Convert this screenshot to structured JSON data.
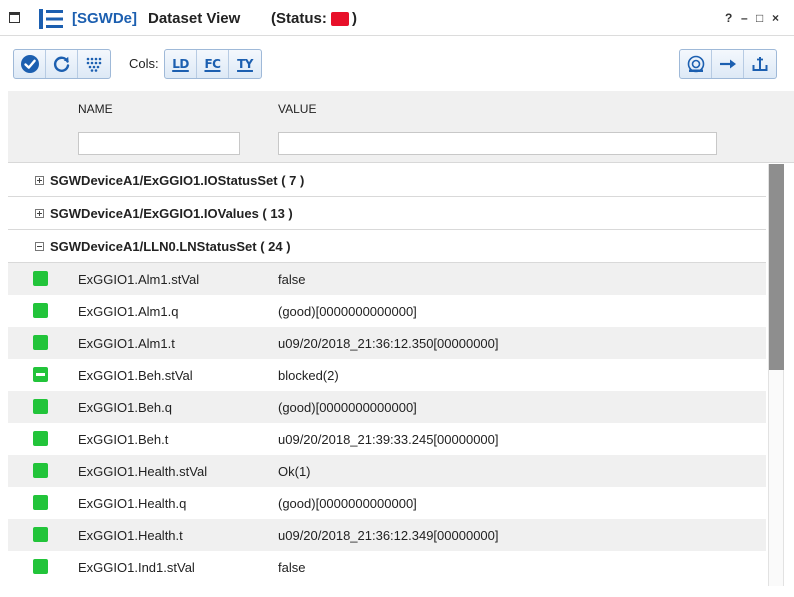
{
  "window": {
    "app_tag": "[SGWDe]",
    "view_title": "Dataset View",
    "status_prefix": "(Status:",
    "status_suffix": ")",
    "status_color": "#e8102a",
    "controls": [
      "?",
      "–",
      "□",
      "×"
    ]
  },
  "toolbar": {
    "left_buttons": [
      "check-circle-icon",
      "refresh-icon",
      "dots-grid-icon"
    ],
    "cols_label": "Cols:",
    "col_buttons": [
      "LD",
      "FC",
      "TY"
    ],
    "right_buttons": [
      "camera-icon",
      "arrow-right-icon",
      "anchor-icon"
    ],
    "accent_color": "#1c5fb0"
  },
  "columns": {
    "name_header": "NAME",
    "value_header": "VALUE",
    "name_filter": "",
    "value_filter": ""
  },
  "groups": [
    {
      "label": "SGWDeviceA1/ExGGIO1.IOStatusSet ( 7 )",
      "expanded": false
    },
    {
      "label": "SGWDeviceA1/ExGGIO1.IOValues ( 13 )",
      "expanded": false
    },
    {
      "label": "SGWDeviceA1/LLN0.LNStatusSet ( 24 )",
      "expanded": true
    }
  ],
  "rows": [
    {
      "name": "ExGGIO1.Alm1.stVal",
      "value": "false",
      "status": "good"
    },
    {
      "name": "ExGGIO1.Alm1.q",
      "value": "(good)[0000000000000]",
      "status": "good"
    },
    {
      "name": "ExGGIO1.Alm1.t",
      "value": "u09/20/2018_21:36:12.350[00000000]",
      "status": "good"
    },
    {
      "name": "ExGGIO1.Beh.stVal",
      "value": "blocked(2)",
      "status": "blocked"
    },
    {
      "name": "ExGGIO1.Beh.q",
      "value": "(good)[0000000000000]",
      "status": "good"
    },
    {
      "name": "ExGGIO1.Beh.t",
      "value": "u09/20/2018_21:39:33.245[00000000]",
      "status": "good"
    },
    {
      "name": "ExGGIO1.Health.stVal",
      "value": "Ok(1)",
      "status": "good"
    },
    {
      "name": "ExGGIO1.Health.q",
      "value": "(good)[0000000000000]",
      "status": "good"
    },
    {
      "name": "ExGGIO1.Health.t",
      "value": "u09/20/2018_21:36:12.349[00000000]",
      "status": "good"
    },
    {
      "name": "ExGGIO1.Ind1.stVal",
      "value": "false",
      "status": "good"
    }
  ],
  "status_colors": {
    "good": "#22c43a"
  }
}
